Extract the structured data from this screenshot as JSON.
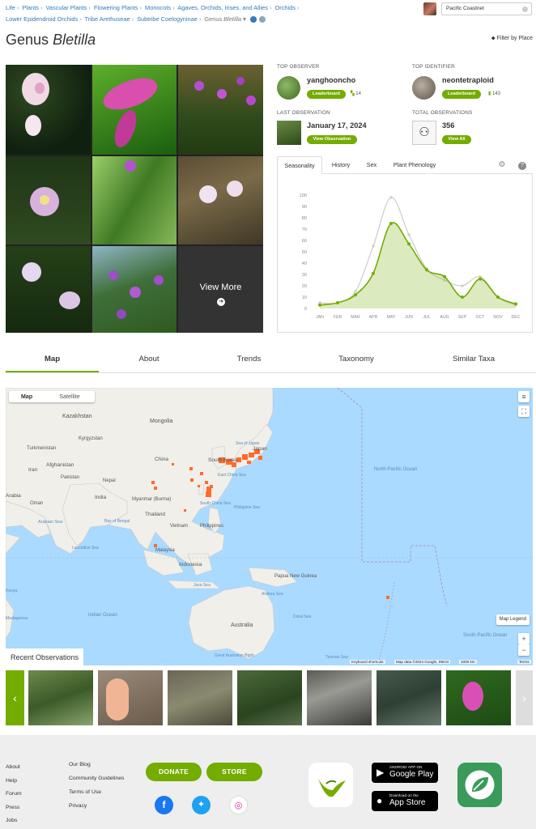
{
  "breadcrumb": {
    "items": [
      "Life",
      "Plants",
      "Vascular Plants",
      "Flowering Plants",
      "Monocots",
      "Agaves, Orchids, Irises, and Allies",
      "Orchids",
      "Lower Epidendroid Orchids",
      "Tribe Arethuseae",
      "Subtribe Coelogyninae"
    ],
    "current_rank": "Genus",
    "current_name": "Bletilla",
    "current_arrow": "▾"
  },
  "place_search": {
    "value": "Pacific Coastnet"
  },
  "page": {
    "title_rank": "Genus",
    "title_name": "Bletilla",
    "filter_label": "Filter by Place"
  },
  "photos": {
    "view_more": "View More"
  },
  "top_observer": {
    "label": "TOP OBSERVER",
    "name": "yanghooncho",
    "button": "Leaderboard",
    "count": "14"
  },
  "top_identifier": {
    "label": "TOP IDENTIFIER",
    "name": "neontetraploid",
    "button": "Leaderboard",
    "count": "143"
  },
  "last_observation": {
    "label": "LAST OBSERVATION",
    "date": "January 17, 2024",
    "button": "View Observation"
  },
  "total_observations": {
    "label": "TOTAL OBSERVATIONS",
    "count": "356",
    "button": "View All"
  },
  "chart_tabs": [
    "Seasonality",
    "History",
    "Sex",
    "Plant Phenology"
  ],
  "chart_data": {
    "type": "line",
    "categories": [
      "JAN",
      "FEB",
      "MAR",
      "APR",
      "MAY",
      "JUN",
      "JUL",
      "AUG",
      "SEP",
      "OCT",
      "NOV",
      "DEC"
    ],
    "series": [
      {
        "values": [
          5,
          5,
          15,
          55,
          98,
          65,
          35,
          25,
          20,
          28,
          10,
          3
        ],
        "color": "#cccccc"
      },
      {
        "values": [
          3,
          5,
          12,
          31,
          75,
          57,
          34,
          28,
          10,
          26,
          10,
          4
        ],
        "color": "#74ac00"
      }
    ],
    "ylim": [
      0,
      100
    ],
    "yticks": [
      "0",
      "10",
      "20",
      "30",
      "40",
      "50",
      "60",
      "70",
      "80",
      "90",
      "100"
    ]
  },
  "section_tabs": [
    "Map",
    "About",
    "Trends",
    "Taxonomy",
    "Similar Taxa"
  ],
  "map": {
    "toggle": [
      "Map",
      "Satellite"
    ],
    "labels": [
      {
        "t": "Kazakhstan"
      },
      {
        "t": "Mongolia"
      },
      {
        "t": "Kyrgyzstan"
      },
      {
        "t": "Turkmenistan"
      },
      {
        "t": "Afghanistan"
      },
      {
        "t": "Iran"
      },
      {
        "t": "Pakistan"
      },
      {
        "t": "China"
      },
      {
        "t": "South Korea"
      },
      {
        "t": "Japan"
      },
      {
        "t": "Nepal"
      },
      {
        "t": "India"
      },
      {
        "t": "Arabia"
      },
      {
        "t": "Oman"
      },
      {
        "t": "Myanmar (Burma)"
      },
      {
        "t": "Thailand"
      },
      {
        "t": "Vietnam"
      },
      {
        "t": "Philippines"
      },
      {
        "t": "Malaysia"
      },
      {
        "t": "Indonesia"
      },
      {
        "t": "Papua New Guinea"
      },
      {
        "t": "Australia"
      },
      {
        "t": "North Pacific Ocean"
      },
      {
        "t": "South Pacific Ocean"
      },
      {
        "t": "Indian Ocean"
      },
      {
        "t": "Arabian Sea"
      },
      {
        "t": "Bay of Bengal"
      },
      {
        "t": "Philippine Sea"
      },
      {
        "t": "Sea of Japan"
      },
      {
        "t": "East China Sea"
      },
      {
        "t": "South China Sea"
      },
      {
        "t": "Laccadive Sea"
      },
      {
        "t": "Java Sea"
      },
      {
        "t": "Arafura Sea"
      },
      {
        "t": "Coral Sea"
      },
      {
        "t": "Tasman Sea"
      },
      {
        "t": "Great Australian Bight"
      },
      {
        "t": "Madagascar"
      },
      {
        "t": "Kenya"
      }
    ],
    "legend": "Map Legend",
    "footer": [
      "Keyboard shortcuts",
      "Map data ©2024 Google, INEGI",
      "1000 km",
      "Terms"
    ]
  },
  "recent": {
    "label": "Recent Observations",
    "prev": "‹",
    "next": "›"
  },
  "footer": {
    "col1": [
      "About",
      "Help",
      "Forum",
      "Press",
      "Jobs"
    ],
    "col2": [
      "Our Blog",
      "Community Guidelines",
      "Terms of Use",
      "Privacy"
    ],
    "donate": "DONATE",
    "store": "STORE",
    "google_small": "ANDROID APP ON",
    "google_big": "Google Play",
    "apple_small": "Download on the",
    "apple_big": "App Store"
  },
  "colors": {
    "accent": "#74ac00",
    "link": "#337ab7",
    "ocean": "#aadaff",
    "land": "#f0efe9",
    "observation": "#ff6b2d"
  }
}
